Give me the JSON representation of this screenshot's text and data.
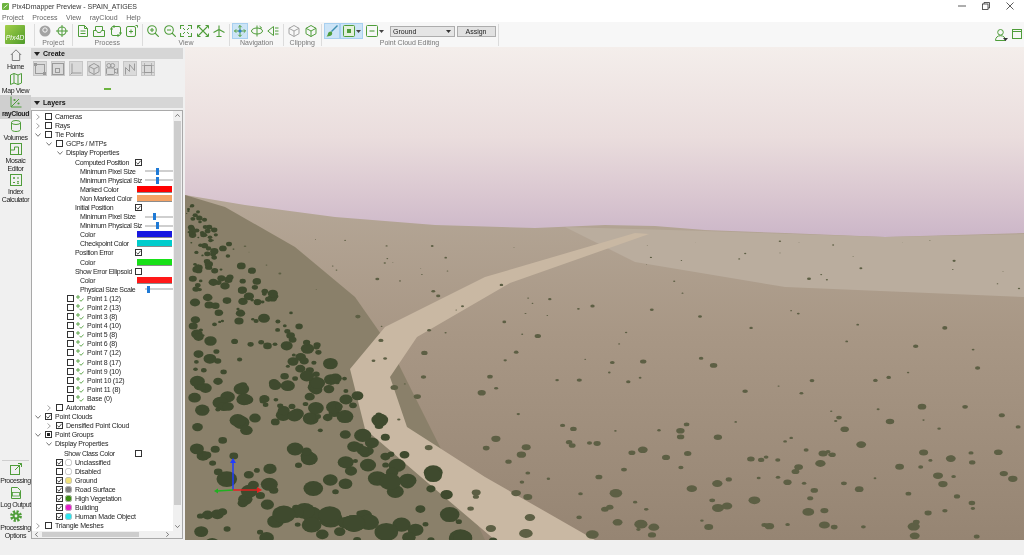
{
  "window": {
    "title": "Pix4Dmapper Preview - SPAIN_ATIGES"
  },
  "menu": [
    "Project",
    "Process",
    "View",
    "rayCloud",
    "Help"
  ],
  "toolbar": {
    "logo": "Pix4D",
    "groups": [
      {
        "label": "Project",
        "buttons": [
          {
            "selected": false,
            "disabled": true
          },
          {
            "selected": false,
            "disabled": false
          }
        ]
      },
      {
        "label": "Process",
        "buttons": [
          {
            "selected": false,
            "disabled": false
          },
          {
            "selected": false,
            "disabled": false
          },
          {
            "selected": false,
            "disabled": false
          },
          {
            "selected": false,
            "disabled": false
          }
        ]
      },
      {
        "label": "View",
        "buttons": [
          {
            "selected": false,
            "disabled": false
          },
          {
            "selected": false,
            "disabled": false
          },
          {
            "selected": false,
            "disabled": false
          },
          {
            "selected": false,
            "disabled": false
          },
          {
            "selected": false,
            "disabled": false
          }
        ]
      },
      {
        "label": "Navigation",
        "buttons": [
          {
            "selected": true,
            "disabled": false
          },
          {
            "selected": false,
            "disabled": false
          },
          {
            "selected": false,
            "disabled": false
          }
        ]
      },
      {
        "label": "Clipping",
        "buttons": [
          {
            "selected": false,
            "disabled": true
          },
          {
            "selected": false,
            "disabled": false
          }
        ]
      },
      {
        "label": "Point Cloud Editing",
        "buttons": [
          {
            "selected": true,
            "disabled": false,
            "menu": false
          },
          {
            "selected": true,
            "disabled": false,
            "menu": true
          },
          {
            "selected": false,
            "disabled": false,
            "menu": true
          }
        ],
        "class_select": {
          "value": "Ground"
        },
        "assign_button": "Assign"
      }
    ]
  },
  "nav": {
    "top": [
      {
        "label": "Home",
        "selected": false
      },
      {
        "label": "Map View",
        "selected": false
      },
      {
        "label": "rayCloud",
        "selected": true
      },
      {
        "label": "Volumes",
        "selected": false
      },
      {
        "label": "Mosaic Editor",
        "selected": false
      },
      {
        "label": "Index Calculator",
        "selected": false
      }
    ],
    "bottom": [
      {
        "label": "Processing"
      },
      {
        "label": "Log Output"
      },
      {
        "label": "Processing Options"
      }
    ]
  },
  "panel": {
    "create": {
      "title": "Create",
      "tools": [
        {
          "disabled": true
        },
        {
          "disabled": true
        },
        {
          "disabled": true
        },
        {
          "disabled": true
        },
        {
          "disabled": true
        },
        {
          "disabled": true
        },
        {
          "disabled": true
        }
      ]
    },
    "layers": {
      "title": "Layers",
      "tree": [
        {
          "kind": "layer",
          "label": "Cameras",
          "expanded": false,
          "checked": false,
          "partial": false
        },
        {
          "kind": "layer",
          "label": "Rays",
          "expanded": false,
          "checked": false,
          "partial": false
        },
        {
          "kind": "layer",
          "label": "Tie Points",
          "expanded": true,
          "checked": false,
          "partial": false,
          "children": [
            {
              "kind": "layer",
              "label": "GCPs / MTPs",
              "expanded": true,
              "checked": false,
              "partial": false,
              "children": [
                {
                  "kind": "group",
                  "label": "Display Properties",
                  "expanded": true,
                  "children": [
                    {
                      "kind": "toggle",
                      "label": "Computed Position",
                      "checked": true,
                      "children": [
                        {
                          "kind": "slider",
                          "label": "Minimum Pixel Size",
                          "level": 0.45
                        },
                        {
                          "kind": "slider",
                          "label": "Minimum Physical Siz",
                          "level": 0.45
                        },
                        {
                          "kind": "color",
                          "label": "Marked Color",
                          "color": "#ff0000"
                        },
                        {
                          "kind": "color",
                          "label": "Non Marked Color",
                          "color": "#f4a264"
                        }
                      ]
                    },
                    {
                      "kind": "toggle",
                      "label": "Initial Position",
                      "checked": true,
                      "children": [
                        {
                          "kind": "slider",
                          "label": "Minimum Pixel Size",
                          "level": 0.33
                        },
                        {
                          "kind": "slider",
                          "label": "Minimum Physical Siz",
                          "level": 0.45
                        },
                        {
                          "kind": "color",
                          "label": "Color",
                          "color": "#1818e0"
                        },
                        {
                          "kind": "color",
                          "label": "Checkpoint Color",
                          "color": "#00cccc"
                        }
                      ]
                    },
                    {
                      "kind": "toggle",
                      "label": "Position Error",
                      "checked": true,
                      "children": [
                        {
                          "kind": "color",
                          "label": "Color",
                          "color": "#18e018"
                        }
                      ]
                    },
                    {
                      "kind": "toggle",
                      "label": "Show Error Ellipsoid",
                      "checked": false,
                      "children": [
                        {
                          "kind": "color",
                          "label": "Color",
                          "color": "#ff1818"
                        },
                        {
                          "kind": "slider",
                          "label": "Physical Size Scale",
                          "level": 0.08
                        }
                      ]
                    }
                  ]
                },
                {
                  "kind": "point",
                  "label": "Point 1 (12)",
                  "checked": false
                },
                {
                  "kind": "point",
                  "label": "Point 2 (13)",
                  "checked": false
                },
                {
                  "kind": "point",
                  "label": "Point 3 (8)",
                  "checked": false
                },
                {
                  "kind": "point",
                  "label": "Point 4 (10)",
                  "checked": false
                },
                {
                  "kind": "point",
                  "label": "Point 5 (8)",
                  "checked": false
                },
                {
                  "kind": "point",
                  "label": "Point 6 (8)",
                  "checked": false
                },
                {
                  "kind": "point",
                  "label": "Point 7 (12)",
                  "checked": false
                },
                {
                  "kind": "point",
                  "label": "Point 8 (17)",
                  "checked": false
                },
                {
                  "kind": "point",
                  "label": "Point 9 (10)",
                  "checked": false
                },
                {
                  "kind": "point",
                  "label": "Point 10 (12)",
                  "checked": false
                },
                {
                  "kind": "point",
                  "label": "Point 11 (8)",
                  "checked": false
                },
                {
                  "kind": "point",
                  "label": "Base (0)",
                  "checked": false
                }
              ]
            },
            {
              "kind": "layer",
              "label": "Automatic",
              "expanded": false,
              "checked": false,
              "partial": false
            }
          ]
        },
        {
          "kind": "layer",
          "label": "Point Clouds",
          "expanded": true,
          "checked": true,
          "partial": false,
          "children": [
            {
              "kind": "layer",
              "label": "Densified Point Cloud",
              "expanded": false,
              "checked": true,
              "partial": false
            }
          ]
        },
        {
          "kind": "layer",
          "label": "Point Groups",
          "expanded": true,
          "checked": true,
          "partial": true,
          "children": [
            {
              "kind": "group",
              "label": "Display Properties",
              "expanded": true,
              "children": [
                {
                  "kind": "toggle",
                  "label": "Show Class Color",
                  "checked": false
                }
              ]
            },
            {
              "kind": "class",
              "label": "Unclassified",
              "checked": true,
              "color": "#ffffff"
            },
            {
              "kind": "class",
              "label": "Disabled",
              "checked": false,
              "color": "#ffffff"
            },
            {
              "kind": "class",
              "label": "Ground",
              "checked": true,
              "color": "#f2e27a"
            },
            {
              "kind": "class",
              "label": "Road Surface",
              "checked": true,
              "color": "#808080"
            },
            {
              "kind": "class",
              "label": "High Vegetation",
              "checked": true,
              "color": "#3c8c14"
            },
            {
              "kind": "class",
              "label": "Building",
              "checked": true,
              "color": "#e61ec8"
            },
            {
              "kind": "class",
              "label": "Human Made Object",
              "checked": true,
              "color": "#28e6f0"
            }
          ]
        },
        {
          "kind": "layer",
          "label": "Triangle Meshes",
          "expanded": false,
          "checked": false,
          "partial": false
        }
      ]
    }
  }
}
